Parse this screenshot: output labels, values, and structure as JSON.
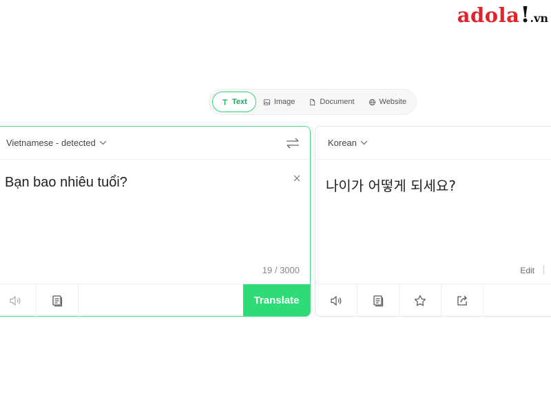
{
  "logo": {
    "main": "adola",
    "bang": "!",
    "suffix": ".vn"
  },
  "tabs": [
    {
      "label": "Text",
      "icon": "text-icon",
      "active": true
    },
    {
      "label": "Image",
      "icon": "image-icon",
      "active": false
    },
    {
      "label": "Document",
      "icon": "document-icon",
      "active": false
    },
    {
      "label": "Website",
      "icon": "globe-icon",
      "active": false
    }
  ],
  "source": {
    "language": "Vietnamese - detected",
    "text": "Bạn bao nhiêu tuổi?",
    "char_count": "19 / 3000",
    "translate_label": "Translate"
  },
  "target": {
    "language": "Korean",
    "text": "나이가 어떻게 되세요?",
    "edit_label": "Edit"
  },
  "colors": {
    "accent": "#2ddb77",
    "logo_red": "#e0242b",
    "border_active": "#49d985"
  }
}
